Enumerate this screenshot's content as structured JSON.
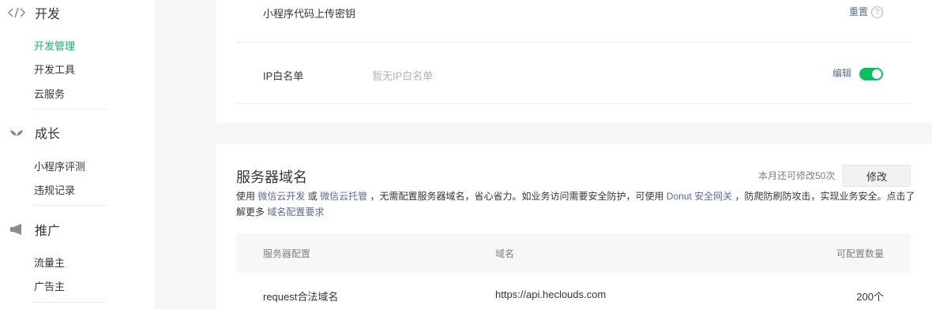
{
  "sidebar": {
    "groups": [
      {
        "icon": "code-icon",
        "title": "开发",
        "items": [
          "开发管理",
          "开发工具",
          "云服务"
        ],
        "active_index": 0
      },
      {
        "icon": "sprout-icon",
        "title": "成长",
        "items": [
          "小程序评测",
          "违规记录"
        ]
      },
      {
        "icon": "megaphone-icon",
        "title": "推广",
        "items": [
          "流量主",
          "广告主"
        ]
      }
    ]
  },
  "dev_settings": {
    "secret_row": {
      "label": "小程序代码上传密钥",
      "action": "重置",
      "help": "?"
    },
    "ip_row": {
      "label": "IP白名单",
      "value": "暂无IP白名单",
      "action": "编辑",
      "toggle_on": true
    }
  },
  "server_domain": {
    "title": "服务器域名",
    "quota_text": "本月还可修改50次",
    "modify_label": "修改",
    "desc": {
      "p1": "使用",
      "link1": "微信云开发",
      "p2": "或",
      "link2": "微信云托管",
      "p3": "，无需配置服务器域名，省心省力。如业务访问需要安全防护，可使用",
      "link3": "Donut 安全网关",
      "p4": "，防爬防刷防攻击，实现业务安全。点击了解更多",
      "link4": "域名配置要求"
    },
    "table": {
      "headers": [
        "服务器配置",
        "域名",
        "可配置数量"
      ],
      "rows": [
        {
          "config": "request合法域名",
          "domain": "https://api.heclouds.com",
          "count": "200个"
        }
      ]
    }
  },
  "colors": {
    "accent_green": "#07c160",
    "link_blue": "#576b95"
  }
}
